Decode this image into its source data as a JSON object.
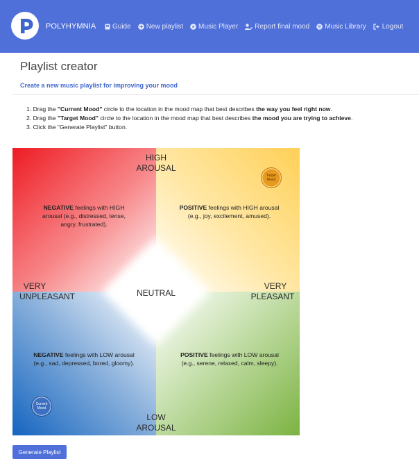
{
  "brand": {
    "name": "POLYHYMNIA",
    "logo_letter": "P"
  },
  "nav": [
    {
      "label": "Guide",
      "icon": "book-icon"
    },
    {
      "label": "New playlist",
      "icon": "plus-circle-icon"
    },
    {
      "label": "Music Player",
      "icon": "play-circle-icon"
    },
    {
      "label": "Report final mood",
      "icon": "user-edit-icon"
    },
    {
      "label": "Music Library",
      "icon": "spotify-icon"
    },
    {
      "label": "Logout",
      "icon": "sign-out-icon"
    }
  ],
  "page": {
    "title": "Playlist creator",
    "subtitle": "Create a new music playlist for improving your mood"
  },
  "steps": [
    {
      "num": "1.",
      "pre": "Drag the ",
      "strong1": "\"Current Mood\"",
      "mid": " circle to the location in the mood map that best describes ",
      "strong2": "the way you feel right now",
      "post": "."
    },
    {
      "num": "2.",
      "pre": "Drag the ",
      "strong1": "\"Target Mood\"",
      "mid": " circle to the location in the mood map that best describes ",
      "strong2": "the mood you are trying to achieve",
      "post": "."
    },
    {
      "num": "3.",
      "text": "Click the \"Generate Playlist\" button."
    }
  ],
  "mood_map": {
    "axes": {
      "high_line1": "HIGH",
      "high_line2": "AROUSAL",
      "low_line1": "LOW",
      "low_line2": "AROUSAL",
      "left_line1": "VERY",
      "left_line2": "UNPLEASANT",
      "right_line1": "VERY",
      "right_line2": "PLEASANT",
      "center": "NEUTRAL"
    },
    "quadrants": {
      "top_left": {
        "strong": "NEGATIVE",
        "text": " feelings with HIGH arousal  (e.g., distressed, tense, angry, frustrated)."
      },
      "top_right": {
        "strong": "POSITIVE",
        "text": " feelings with HIGH arousal (e.g., joy, excitement, amused)."
      },
      "bottom_left": {
        "strong": "NEGATIVE",
        "text": " feelings with LOW arousal (e.g., sad, depressed, bored, gloomy)."
      },
      "bottom_right": {
        "strong": "POSITIVE",
        "text": " feelings with LOW arousal (e.g., serene, relaxed, calm, sleepy)."
      }
    },
    "target_circle": {
      "line1": "Target",
      "line2": "Mood"
    },
    "current_circle": {
      "line1": "Current",
      "line2": "Mood"
    },
    "colors": {
      "top_left": "#ee1c24",
      "top_right": "#ffd057",
      "bottom_left": "#1565c0",
      "bottom_right": "#7cb342"
    }
  },
  "button": {
    "generate": "Generate Playlist"
  },
  "colors": {
    "navbar": "#4f6fd9",
    "accent": "#3f66cc"
  }
}
